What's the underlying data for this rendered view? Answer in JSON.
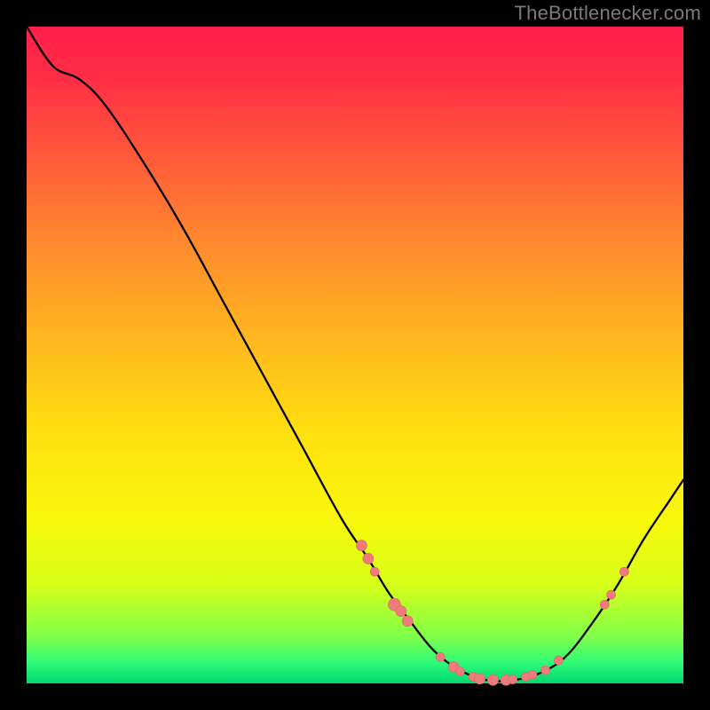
{
  "attribution": "TheBottlenecker.com",
  "colors": {
    "background": "#000000",
    "attribution_text": "#7a7a7a",
    "curve_stroke": "#000000",
    "marker_fill": "#f07b7b",
    "gradient_stops": [
      "#ff1f4a",
      "#ff2e45",
      "#ff5a3a",
      "#ff8a2e",
      "#ffb81f",
      "#ffe010",
      "#f9f80a",
      "#d7ff1a",
      "#7dff4a",
      "#2bfa7a",
      "#00d86e"
    ]
  },
  "chart_data": {
    "type": "line",
    "title": "",
    "xlabel": "",
    "ylabel": "",
    "xlim": [
      0,
      100
    ],
    "ylim": [
      0,
      100
    ],
    "grid": false,
    "legend": false,
    "notes": "Bottleneck-style V-curve. Y is mismatch/bottleneck percentage (0 = optimal, green band near bottom). X is a relative hardware scale (0–100). Axis ticks/labels are not shown in the source image; numeric values are estimated from curve geometry against the 0–100 frame.",
    "curve_points": [
      {
        "x": 0,
        "y": 100
      },
      {
        "x": 4,
        "y": 94
      },
      {
        "x": 8,
        "y": 92
      },
      {
        "x": 12,
        "y": 88
      },
      {
        "x": 18,
        "y": 79
      },
      {
        "x": 24,
        "y": 69
      },
      {
        "x": 30,
        "y": 58
      },
      {
        "x": 36,
        "y": 47
      },
      {
        "x": 42,
        "y": 36
      },
      {
        "x": 48,
        "y": 25
      },
      {
        "x": 52,
        "y": 19
      },
      {
        "x": 55,
        "y": 14
      },
      {
        "x": 58,
        "y": 10
      },
      {
        "x": 62,
        "y": 5
      },
      {
        "x": 66,
        "y": 2
      },
      {
        "x": 70,
        "y": 0.5
      },
      {
        "x": 74,
        "y": 0.5
      },
      {
        "x": 78,
        "y": 1.5
      },
      {
        "x": 82,
        "y": 4
      },
      {
        "x": 86,
        "y": 9
      },
      {
        "x": 90,
        "y": 15
      },
      {
        "x": 94,
        "y": 22
      },
      {
        "x": 98,
        "y": 28
      },
      {
        "x": 100,
        "y": 31
      }
    ],
    "markers": [
      {
        "x": 51,
        "y": 21,
        "r": 6
      },
      {
        "x": 52,
        "y": 19,
        "r": 6
      },
      {
        "x": 53,
        "y": 17,
        "r": 5
      },
      {
        "x": 56,
        "y": 12,
        "r": 7
      },
      {
        "x": 57,
        "y": 11,
        "r": 6
      },
      {
        "x": 58,
        "y": 9.5,
        "r": 6
      },
      {
        "x": 63,
        "y": 4,
        "r": 5
      },
      {
        "x": 65,
        "y": 2.5,
        "r": 6
      },
      {
        "x": 66,
        "y": 1.8,
        "r": 5
      },
      {
        "x": 68,
        "y": 1,
        "r": 5
      },
      {
        "x": 69,
        "y": 0.7,
        "r": 6
      },
      {
        "x": 71,
        "y": 0.5,
        "r": 6
      },
      {
        "x": 73,
        "y": 0.5,
        "r": 6
      },
      {
        "x": 74,
        "y": 0.6,
        "r": 5
      },
      {
        "x": 76,
        "y": 1,
        "r": 5
      },
      {
        "x": 77,
        "y": 1.3,
        "r": 5
      },
      {
        "x": 79,
        "y": 2,
        "r": 5
      },
      {
        "x": 81,
        "y": 3.5,
        "r": 5
      },
      {
        "x": 88,
        "y": 12,
        "r": 5
      },
      {
        "x": 89,
        "y": 13.5,
        "r": 5
      },
      {
        "x": 91,
        "y": 17,
        "r": 5
      }
    ]
  }
}
